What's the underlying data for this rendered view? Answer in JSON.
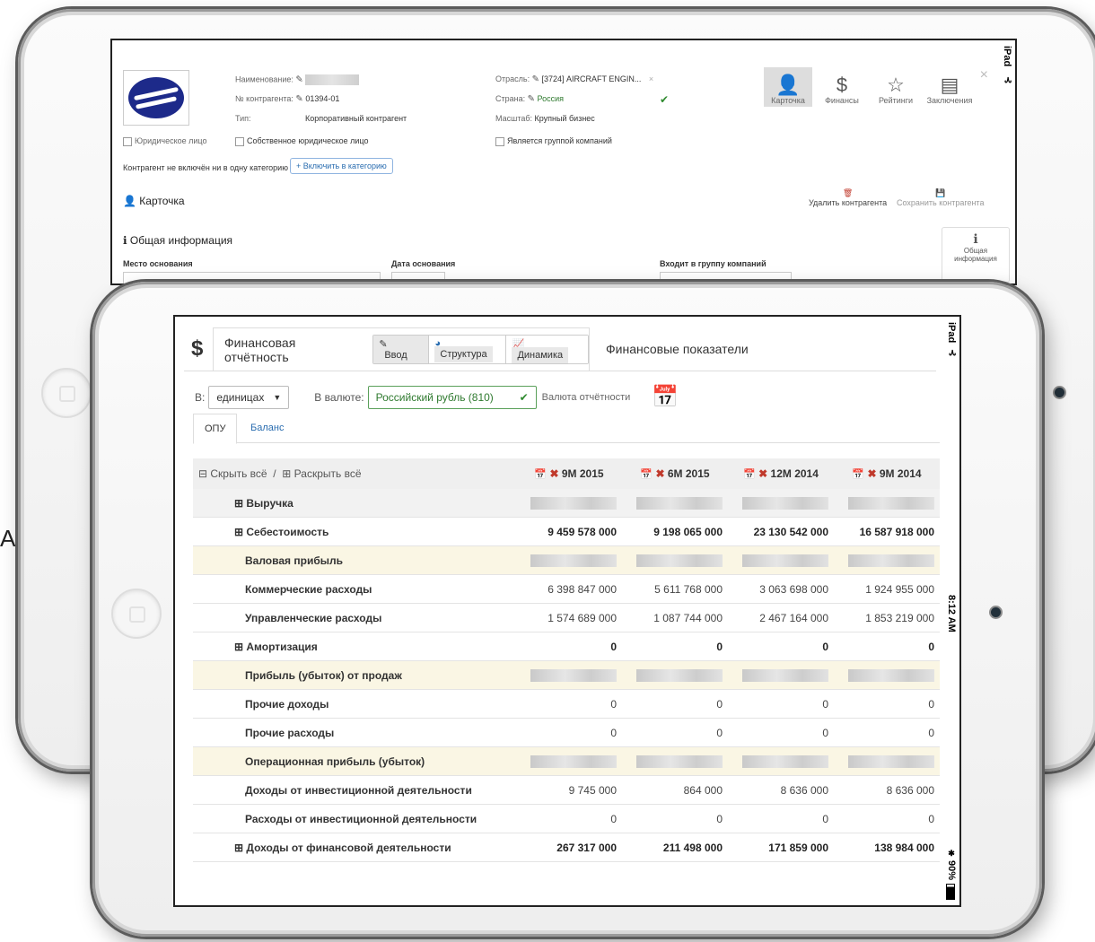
{
  "stray_char": "A",
  "back": {
    "device_label": "iPad",
    "name_label": "Наименование:",
    "contractor_no_label": "№ контрагента:",
    "contractor_no": "01394-01",
    "type_label": "Тип:",
    "type_value": "Корпоративный контрагент",
    "industry_label": "Отрасль:",
    "industry_value": "[3724] AIRCRAFT ENGIN...",
    "country_label": "Страна:",
    "country_value": "Россия",
    "scale_label": "Масштаб:",
    "scale_value": "Крупный бизнес",
    "legal_entity": "Юридическое лицо",
    "own_legal_entity": "Собственное юридическое лицо",
    "is_group": "Является группой компаний",
    "not_in_category": "Контрагент не включён ни в одну категорию",
    "include_btn": "+ Включить в категорию",
    "nav": [
      {
        "label": "Карточка",
        "icon": "person-icon"
      },
      {
        "label": "Финансы",
        "icon": "dollar-icon"
      },
      {
        "label": "Рейтинги",
        "icon": "star-icon"
      },
      {
        "label": "Заключения",
        "icon": "document-icon"
      }
    ],
    "card_title": "Карточка",
    "delete_btn": "Удалить контрагента",
    "save_btn": "Сохранить контрагента",
    "general_info": "Общая информация",
    "general_info_btn": "Общая информация",
    "place_label": "Место основания",
    "date_label": "Дата основания",
    "group_label": "Входит в группу компаний"
  },
  "front": {
    "device_label": "iPad",
    "time": "8:12 AM",
    "battery": "90%",
    "tab_fin_report": "Финансовая отчётность",
    "btn_input": "Ввод",
    "btn_structure": "Структура",
    "btn_dynamics": "Динамика",
    "tab_fin_indicators": "Финансовые показатели",
    "units_label": "В:",
    "units_value": "единицах",
    "currency_label": "В валюте:",
    "currency_value": "Российский рубль (810)",
    "report_currency": "Валюта отчётности",
    "subtab_opu": "ОПУ",
    "subtab_balance": "Баланс",
    "collapse_all": "⊟ Скрыть всё",
    "separator": "/",
    "expand_all": "⊞ Раскрыть всё",
    "periods": [
      {
        "label": "9M 2015",
        "removable": true
      },
      {
        "label": "6M 2015",
        "removable": true
      },
      {
        "label": "12M 2014",
        "removable": true
      },
      {
        "label": "9M 2014",
        "removable": true
      }
    ],
    "rows": [
      {
        "name": "⊞ Выручка",
        "style": "exp",
        "hl": "alt",
        "values": [
          "",
          "",
          "",
          ""
        ],
        "hidden": true,
        "bold": true
      },
      {
        "name": "⊞ Себестоимость",
        "style": "exp",
        "hl": "",
        "values": [
          "9 459 578 000",
          "9 198 065 000",
          "23 130 542 000",
          "16 587 918 000"
        ],
        "hidden": false,
        "bold": true
      },
      {
        "name": "Валовая прибыль",
        "style": "plain",
        "hl": "gold",
        "values": [
          "",
          "",
          "",
          ""
        ],
        "hidden": true,
        "bold": false
      },
      {
        "name": "Коммерческие расходы",
        "style": "plain",
        "hl": "",
        "values": [
          "6 398 847 000",
          "5 611 768 000",
          "3 063 698 000",
          "1 924 955 000"
        ],
        "hidden": false,
        "bold": false
      },
      {
        "name": "Управленческие расходы",
        "style": "plain",
        "hl": "",
        "values": [
          "1 574 689 000",
          "1 087 744 000",
          "2 467 164 000",
          "1 853 219 000"
        ],
        "hidden": false,
        "bold": false
      },
      {
        "name": "⊞ Амортизация",
        "style": "exp",
        "hl": "",
        "values": [
          "0",
          "0",
          "0",
          "0"
        ],
        "hidden": false,
        "bold": true
      },
      {
        "name": "Прибыль (убыток) от продаж",
        "style": "plain",
        "hl": "gold",
        "values": [
          "",
          "",
          "",
          ""
        ],
        "hidden": true,
        "bold": false
      },
      {
        "name": "Прочие доходы",
        "style": "plain",
        "hl": "",
        "values": [
          "0",
          "0",
          "0",
          "0"
        ],
        "hidden": false,
        "bold": false
      },
      {
        "name": "Прочие расходы",
        "style": "plain",
        "hl": "",
        "values": [
          "0",
          "0",
          "0",
          "0"
        ],
        "hidden": false,
        "bold": false
      },
      {
        "name": "Операционная прибыль (убыток)",
        "style": "plain",
        "hl": "gold",
        "values": [
          "",
          "",
          "",
          ""
        ],
        "hidden": true,
        "bold": false
      },
      {
        "name": "Доходы от инвестиционной деятельности",
        "style": "plain",
        "hl": "",
        "values": [
          "9 745 000",
          "864 000",
          "8 636 000",
          "8 636 000"
        ],
        "hidden": false,
        "bold": false
      },
      {
        "name": "Расходы от инвестиционной деятельности",
        "style": "plain",
        "hl": "",
        "values": [
          "0",
          "0",
          "0",
          "0"
        ],
        "hidden": false,
        "bold": false
      },
      {
        "name": "⊞ Доходы от финансовой деятельности",
        "style": "exp",
        "hl": "",
        "values": [
          "267 317 000",
          "211 498 000",
          "171 859 000",
          "138 984 000"
        ],
        "hidden": false,
        "bold": true
      }
    ]
  }
}
